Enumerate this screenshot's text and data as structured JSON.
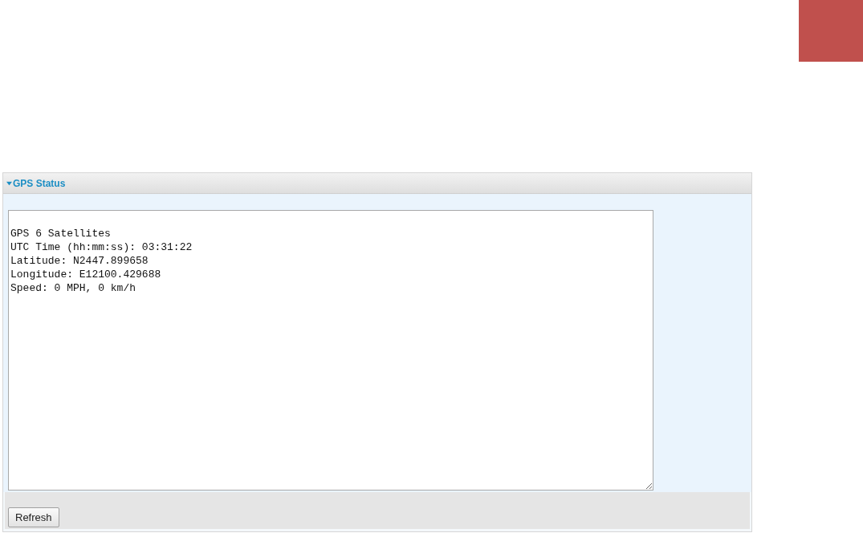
{
  "panel": {
    "title": "GPS Status",
    "expanded": true,
    "status_lines": [
      "GPS 6 Satellites",
      "UTC Time (hh:mm:ss): 03:31:22",
      "Latitude: N2447.899658",
      "Longitude: E12100.429688",
      "Speed: 0 MPH, 0 km/h"
    ],
    "buttons": [
      "Refresh"
    ]
  }
}
